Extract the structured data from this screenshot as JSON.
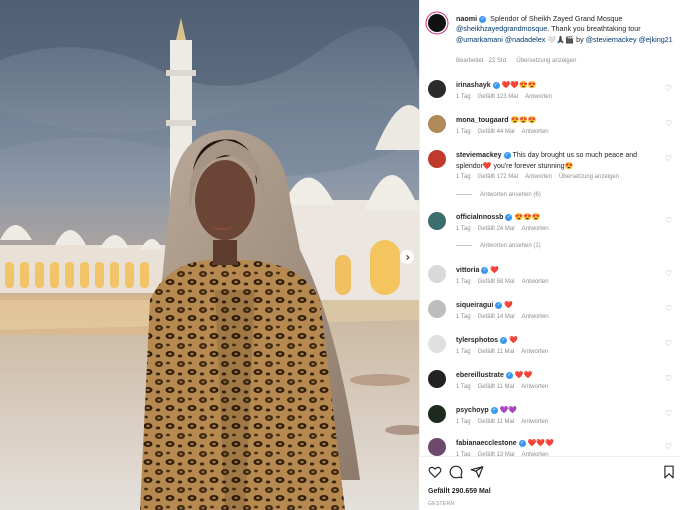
{
  "caption": {
    "username": "naomi",
    "text1": "Splendor of Sheikh Zayed Grand Mosque",
    "mentions1": "@sheikhzayedgrandmosque",
    "text2": ". Thank you breathtaking tour",
    "mentions2": "@umarkamani @nadadelex",
    "emojis": "🤍🙏🏿🎬",
    "by_text": "by",
    "mention3": "@steviemackey",
    "mention4": "@ejking21",
    "edited": "Bearbeitet · 22 Std.",
    "translate": "Übersetzung anzeigen"
  },
  "labels": {
    "reply": "Antworten",
    "translate": "Übersetzung anzeigen"
  },
  "comments": [
    {
      "user": "irinashayk",
      "verified": true,
      "text": "❤️❤️😍😍",
      "time": "1 Tag",
      "likes": "Gefällt 123 Mal",
      "avatar_color": "#2b2b2b"
    },
    {
      "user": "mona_tougaard",
      "verified": false,
      "text": "😍😍😍",
      "time": "1 Tag",
      "likes": "Gefällt 44 Mal",
      "avatar_color": "#b08a5a"
    },
    {
      "user": "steviemackey",
      "verified": true,
      "text": "This day brought us so much peace and splendor❤️ you're forever stunning😍",
      "time": "1 Tag",
      "likes": "Gefällt 172 Mal",
      "avatar_color": "#c0392b",
      "replies": "Antworten ansehen (6)"
    },
    {
      "user": "officialnnossb",
      "verified": true,
      "text": "😍😍😍",
      "time": "1 Tag",
      "likes": "Gefällt 24 Mal",
      "avatar_color": "#3b6e6e",
      "replies": "Antworten ansehen (1)"
    },
    {
      "user": "vittoria",
      "verified": true,
      "text": "❤️",
      "time": "1 Tag",
      "likes": "Gefällt 58 Mal",
      "avatar_color": "#d9d9d9"
    },
    {
      "user": "siqueiragui",
      "verified": true,
      "text": "❤️",
      "time": "1 Tag",
      "likes": "Gefällt 14 Mal",
      "avatar_color": "#bdbdbd"
    },
    {
      "user": "tylersphotos",
      "verified": true,
      "text": "❤️",
      "time": "1 Tag",
      "likes": "Gefällt 11 Mal",
      "avatar_color": "#e0e0e0"
    },
    {
      "user": "ebereillustrate",
      "verified": true,
      "text": "❤️❤️",
      "time": "1 Tag",
      "likes": "Gefällt 11 Mal",
      "avatar_color": "#222222"
    },
    {
      "user": "psychoyp",
      "verified": true,
      "text": "💜💜",
      "time": "1 Tag",
      "likes": "Gefällt 11 Mal",
      "avatar_color": "#1e2a1e"
    },
    {
      "user": "fabianaecclestone",
      "verified": true,
      "text": "❤️❤️❤️",
      "time": "1 Tag",
      "likes": "Gefällt 13 Mal",
      "avatar_color": "#6d4a6d"
    }
  ],
  "footer": {
    "likes": "Gefällt 290.659 Mal",
    "date": "GESTERN"
  },
  "colors": {
    "link": "#00376b",
    "muted": "#8e8e8e",
    "verified": "#3897f0",
    "heart": "#ed4956"
  },
  "icons": [
    "heart-icon",
    "comment-icon",
    "share-icon",
    "bookmark-icon",
    "chevron-right-icon",
    "verified-icon"
  ]
}
